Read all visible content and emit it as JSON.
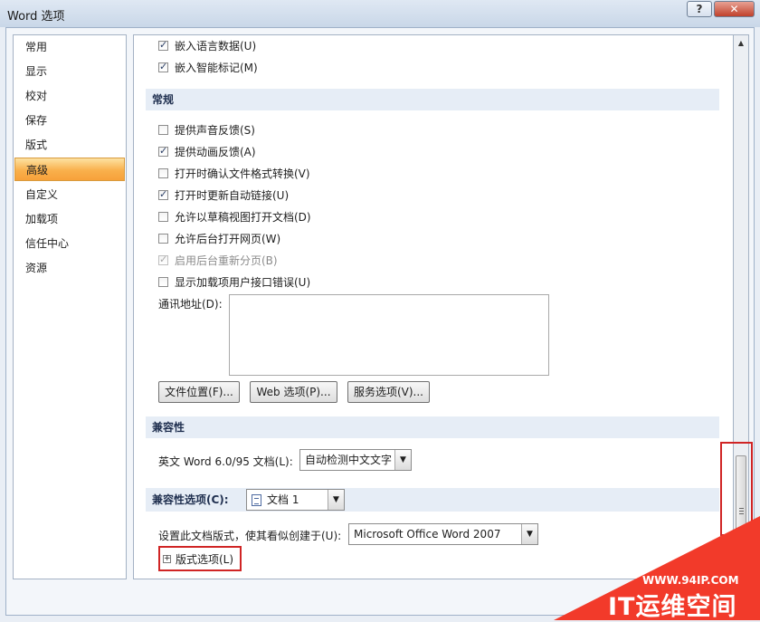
{
  "window": {
    "title": "Word 选项",
    "help_label": "?",
    "close_label": "✕"
  },
  "nav": {
    "items": [
      {
        "label": "常用"
      },
      {
        "label": "显示"
      },
      {
        "label": "校对"
      },
      {
        "label": "保存"
      },
      {
        "label": "版式"
      },
      {
        "label": "高级",
        "active": true
      },
      {
        "label": "自定义"
      },
      {
        "label": "加载项"
      },
      {
        "label": "信任中心"
      },
      {
        "label": "资源"
      }
    ]
  },
  "content": {
    "top_options": [
      {
        "label": "嵌入语言数据(U)",
        "checked": true
      },
      {
        "label": "嵌入智能标记(M)",
        "checked": true
      }
    ],
    "general": {
      "header": "常规",
      "options": [
        {
          "label": "提供声音反馈(S)",
          "checked": false
        },
        {
          "label": "提供动画反馈(A)",
          "checked": true
        },
        {
          "label": "打开时确认文件格式转换(V)",
          "checked": false
        },
        {
          "label": "打开时更新自动链接(U)",
          "checked": true
        },
        {
          "label": "允许以草稿视图打开文档(D)",
          "checked": false
        },
        {
          "label": "允许后台打开网页(W)",
          "checked": false
        },
        {
          "label": "启用后台重新分页(B)",
          "checked": true,
          "disabled": true
        },
        {
          "label": "显示加载项用户接口错误(U)",
          "checked": false
        }
      ],
      "mailing_address_label": "通讯地址(D):",
      "buttons": {
        "file_locations": "文件位置(F)...",
        "web_options": "Web 选项(P)...",
        "service_options": "服务选项(V)..."
      }
    },
    "compat": {
      "header": "兼容性",
      "label": "英文 Word 6.0/95 文档(L):",
      "value": "自动检测中文文字"
    },
    "compat_options": {
      "header": "兼容性选项(C):",
      "doc_value": "文档 1",
      "layout_label": "设置此文档版式，使其看似创建于(U):",
      "layout_value": "Microsoft Office Word 2007",
      "expander_label": "版式选项(L)",
      "expander_symbol": "+"
    }
  },
  "watermark": {
    "url": "WWW.94IP.COM",
    "name": "IT运维空间"
  }
}
